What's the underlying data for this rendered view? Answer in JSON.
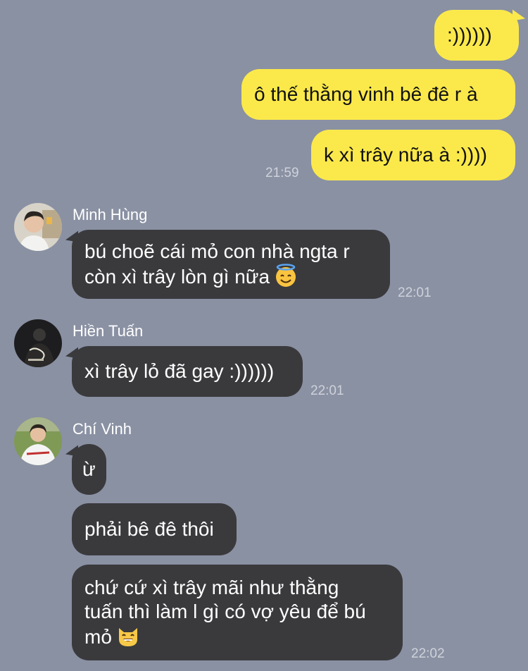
{
  "outgoing": [
    {
      "text": ":))))))"
    },
    {
      "text": "ô thế thằng vinh bê đê r à"
    },
    {
      "text": "k xì trây nữa à :))))",
      "time": "21:59"
    }
  ],
  "contacts": [
    {
      "name": "Minh Hùng",
      "avatar": "person-photo-avatar"
    },
    {
      "name": "Hiền Tuấn",
      "avatar": "dark-photo-avatar"
    },
    {
      "name": "Chí Vinh",
      "avatar": "baseball-jersey-avatar"
    }
  ],
  "incoming": [
    {
      "text": "bú choẽ cái mỏ con nhà ngta r\ncòn xì trây lòn gì nữa",
      "emoji": "smiling-face-with-halo",
      "time": "22:01"
    },
    {
      "text": "xì trây lỏ đã gay :))))))",
      "time": "22:01"
    },
    {
      "text": "ừ"
    },
    {
      "text": "phải bê đê thôi"
    },
    {
      "text": "chứ cứ xì trây mãi như thằng\ntuấn thì làm l gì có vợ yêu để bú\nmỏ",
      "emoji": "grinning-cat-face",
      "time": "22:02"
    }
  ],
  "colors": {
    "background": "#8a91a3",
    "outgoing_bubble": "#fbe94b",
    "incoming_bubble": "#3a3a3d",
    "timestamp": "#cfd2da"
  }
}
